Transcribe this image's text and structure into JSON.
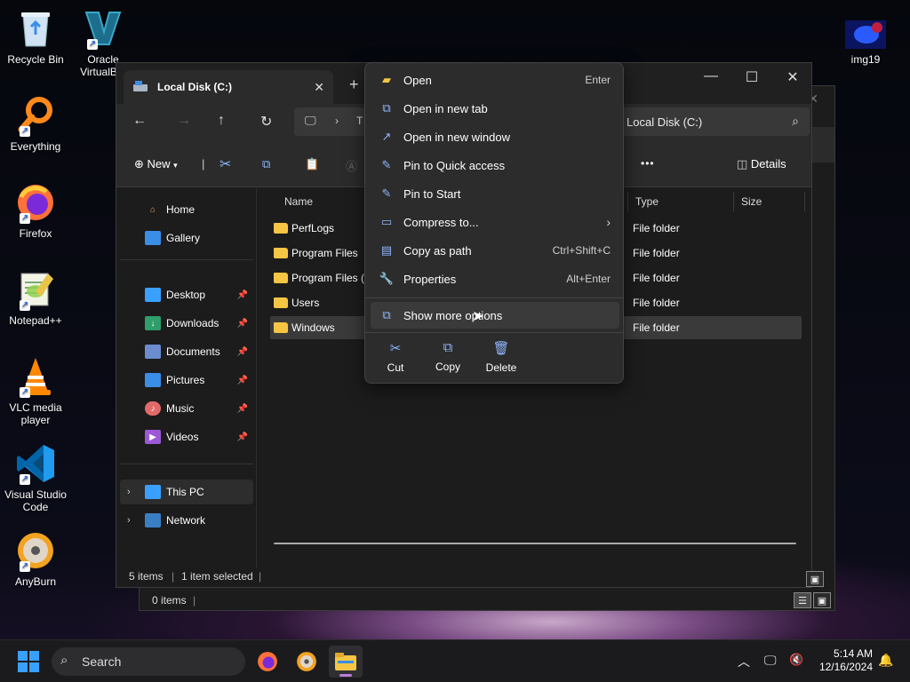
{
  "desktop": {
    "icons": [
      {
        "label": "Recycle Bin"
      },
      {
        "label": "Oracle VirtualB..."
      },
      {
        "label": "Everything"
      },
      {
        "label": "Firefox"
      },
      {
        "label": "Notepad++"
      },
      {
        "label": "VLC media player"
      },
      {
        "label": "Visual Studio Code"
      },
      {
        "label": "AnyBurn"
      },
      {
        "label": "img19"
      }
    ]
  },
  "back_window": {
    "status": "0 items"
  },
  "explorer": {
    "tab_title": "Local Disk (C:)",
    "new_tab": "+",
    "address_partial": "T",
    "search_placeholder": "Local Disk (C:)",
    "command_bar": {
      "new_label": "New",
      "more": "•••",
      "details_label": "Details"
    },
    "sidebar": {
      "items": [
        {
          "label": "Home"
        },
        {
          "label": "Gallery"
        },
        {
          "label": "Desktop"
        },
        {
          "label": "Downloads"
        },
        {
          "label": "Documents"
        },
        {
          "label": "Pictures"
        },
        {
          "label": "Music"
        },
        {
          "label": "Videos"
        },
        {
          "label": "This PC"
        },
        {
          "label": "Network"
        }
      ]
    },
    "columns": {
      "name": "Name",
      "type": "Type",
      "size": "Size"
    },
    "rows": [
      {
        "name": "PerfLogs",
        "type": "File folder"
      },
      {
        "name": "Program Files",
        "type": "File folder"
      },
      {
        "name": "Program Files (x",
        "type": "File folder"
      },
      {
        "name": "Users",
        "type": "File folder"
      },
      {
        "name": "Windows",
        "type": "File folder"
      }
    ],
    "status": {
      "items": "5 items",
      "selected": "1 item selected"
    }
  },
  "context_menu": {
    "items": [
      {
        "label": "Open",
        "shortcut": "Enter"
      },
      {
        "label": "Open in new tab",
        "shortcut": ""
      },
      {
        "label": "Open in new window",
        "shortcut": ""
      },
      {
        "label": "Pin to Quick access",
        "shortcut": ""
      },
      {
        "label": "Pin to Start",
        "shortcut": ""
      },
      {
        "label": "Compress to...",
        "shortcut": ""
      },
      {
        "label": "Copy as path",
        "shortcut": "Ctrl+Shift+C"
      },
      {
        "label": "Properties",
        "shortcut": "Alt+Enter"
      },
      {
        "label": "Show more options",
        "shortcut": ""
      }
    ],
    "quick_actions": [
      {
        "label": "Cut"
      },
      {
        "label": "Copy"
      },
      {
        "label": "Delete"
      }
    ]
  },
  "taskbar": {
    "search_placeholder": "Search",
    "time": "5:14 AM",
    "date": "12/16/2024"
  },
  "colors": {
    "accent": "#3aa0ff",
    "folder": "#f6c544",
    "menu_bg": "#2c2c2c",
    "window_bg": "#1c1c1c"
  }
}
